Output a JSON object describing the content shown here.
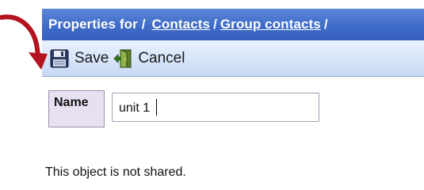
{
  "title": {
    "prefix": "Properties for /",
    "crumbs": [
      "Contacts",
      "Group contacts"
    ],
    "trailing": "/"
  },
  "toolbar": {
    "save_label": "Save",
    "cancel_label": "Cancel"
  },
  "form": {
    "name_label": "Name",
    "name_value": "unit 1"
  },
  "sharing_status": "This object is not shared.",
  "colors": {
    "titlebar": "#3f6cc8",
    "annotation_arrow": "#b3121e"
  },
  "icons": [
    "floppy-disk-icon",
    "door-exit-icon",
    "curved-arrow-icon"
  ]
}
